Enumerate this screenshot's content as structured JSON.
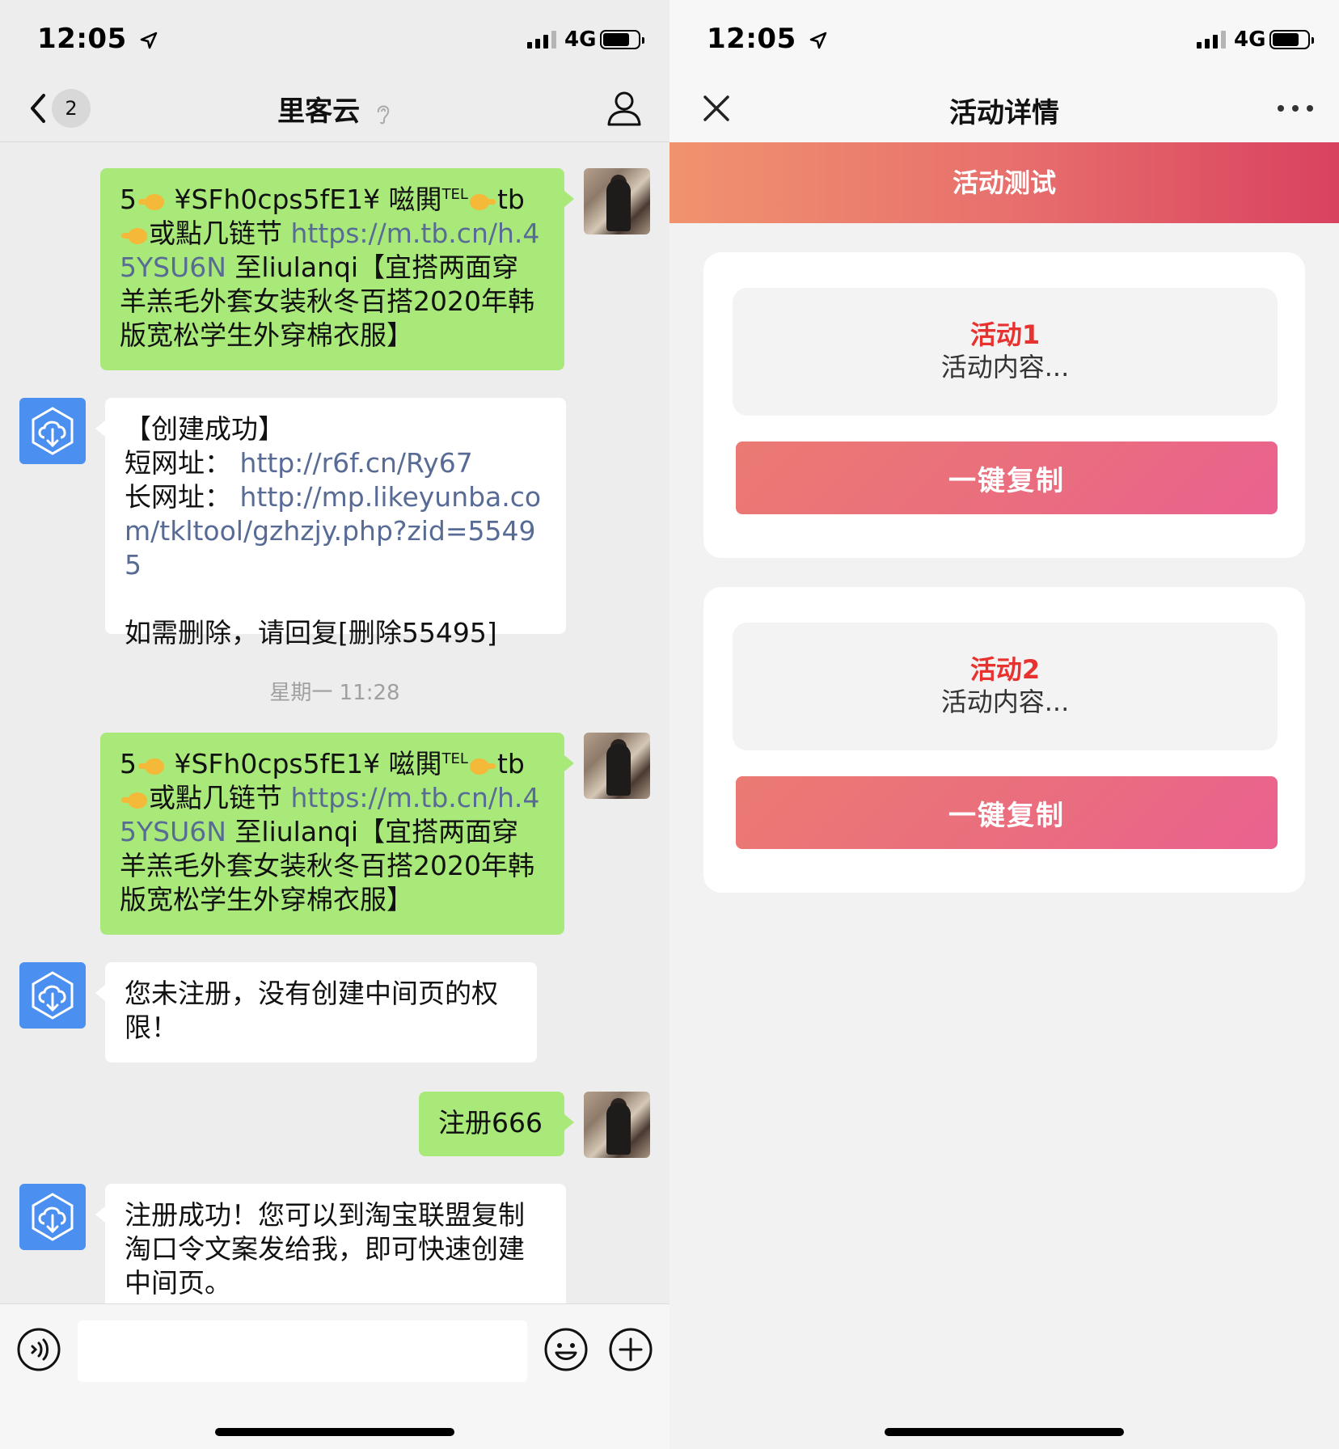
{
  "status": {
    "time": "12:05",
    "network": "4G"
  },
  "chat": {
    "title": "里客云",
    "unread_count": "2",
    "timestamp": "星期一 11:28",
    "messages": {
      "m1": {
        "pre": "5",
        "code": " ¥SFh0cps5fE1¥ 嗞閧",
        "tel": "TEL",
        "tb": "tb",
        "mid": "或點几链节 ",
        "link": "https://m.tb.cn/h.45YSU6N",
        "post": " 至liulanqi【宜搭两面穿羊羔毛外套女装秋冬百搭2020年韩版宽松学生外穿棉衣服】"
      },
      "m2": {
        "line1": "【创建成功】",
        "short_label": "短网址：",
        "short_url": "http://r6f.cn/Ry67",
        "long_label": "长网址：",
        "long_url": "http://mp.likeyunba.com/tkltool/gzhzjy.php?zid=55495",
        "delete_note": "如需删除，请回复[删除55495]"
      },
      "m3": {
        "pre": "5",
        "code": " ¥SFh0cps5fE1¥ 嗞閧",
        "tel": "TEL",
        "tb": "tb",
        "mid": "或點几链节 ",
        "link": "https://m.tb.cn/h.45YSU6N",
        "post": " 至liulanqi【宜搭两面穿羊羔毛外套女装秋冬百搭2020年韩版宽松学生外穿棉衣服】"
      },
      "m4": {
        "text": "您未注册，没有创建中间页的权限！"
      },
      "m5": {
        "text": "注册666"
      },
      "m6": {
        "text": "注册成功！您可以到淘宝联盟复制淘口令文案发给我，即可快速创建中间页。"
      }
    },
    "input": {
      "value": "",
      "placeholder": ""
    }
  },
  "activity": {
    "nav_title": "活动详情",
    "banner": "活动测试",
    "cards": [
      {
        "title": "活动1",
        "content": "活动内容...",
        "button": "一键复制"
      },
      {
        "title": "活动2",
        "content": "活动内容...",
        "button": "一键复制"
      }
    ]
  },
  "colors": {
    "sent_bubble": "#a9e97a",
    "link": "#576b95",
    "accent_red": "#e8322f",
    "banner_start": "#f0936e",
    "banner_end": "#d9425f"
  }
}
